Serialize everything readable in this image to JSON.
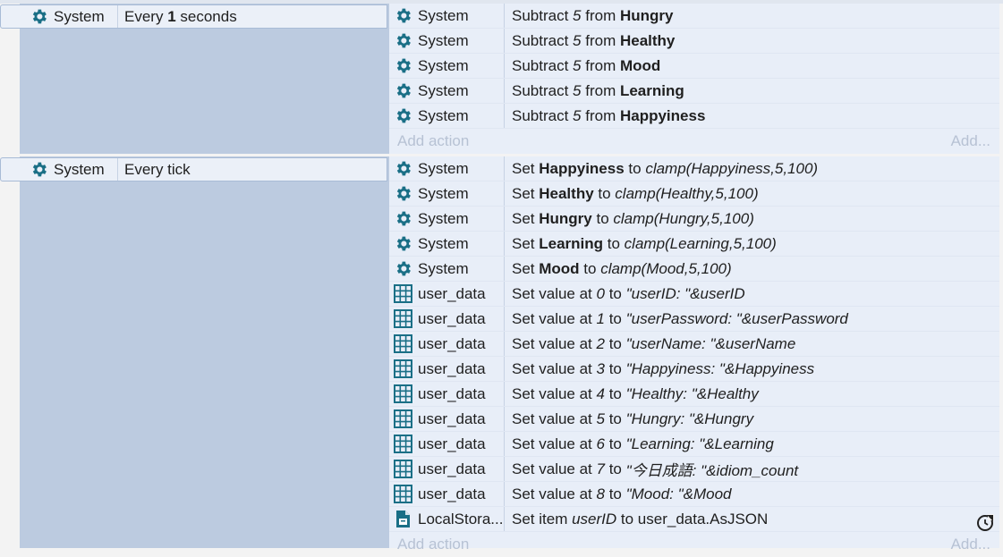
{
  "events": [
    {
      "condition": {
        "object": "System",
        "icon": "gear-icon",
        "text_parts": [
          [
            "Every ",
            "n"
          ],
          [
            "1",
            "b"
          ],
          [
            " seconds",
            "n"
          ]
        ]
      },
      "actions": [
        {
          "object": "System",
          "icon": "gear-icon",
          "parts": [
            [
              "Subtract ",
              "n"
            ],
            [
              "5",
              "i"
            ],
            [
              " from ",
              "n"
            ],
            [
              "Hungry",
              "b"
            ]
          ]
        },
        {
          "object": "System",
          "icon": "gear-icon",
          "parts": [
            [
              "Subtract ",
              "n"
            ],
            [
              "5",
              "i"
            ],
            [
              " from ",
              "n"
            ],
            [
              "Healthy",
              "b"
            ]
          ]
        },
        {
          "object": "System",
          "icon": "gear-icon",
          "parts": [
            [
              "Subtract ",
              "n"
            ],
            [
              "5",
              "i"
            ],
            [
              " from ",
              "n"
            ],
            [
              "Mood",
              "b"
            ]
          ]
        },
        {
          "object": "System",
          "icon": "gear-icon",
          "parts": [
            [
              "Subtract ",
              "n"
            ],
            [
              "5",
              "i"
            ],
            [
              " from ",
              "n"
            ],
            [
              "Learning",
              "b"
            ]
          ]
        },
        {
          "object": "System",
          "icon": "gear-icon",
          "parts": [
            [
              "Subtract ",
              "n"
            ],
            [
              "5",
              "i"
            ],
            [
              " from ",
              "n"
            ],
            [
              "Happyiness",
              "b"
            ]
          ]
        }
      ],
      "add_action": "Add action",
      "add_more": "Add..."
    },
    {
      "condition": {
        "object": "System",
        "icon": "gear-icon",
        "text_parts": [
          [
            "Every tick",
            "n"
          ]
        ]
      },
      "actions": [
        {
          "object": "System",
          "icon": "gear-icon",
          "parts": [
            [
              "Set ",
              "n"
            ],
            [
              "Happyiness",
              "b"
            ],
            [
              " to ",
              "n"
            ],
            [
              "clamp(Happyiness,5,100)",
              "i"
            ]
          ]
        },
        {
          "object": "System",
          "icon": "gear-icon",
          "parts": [
            [
              "Set ",
              "n"
            ],
            [
              "Healthy",
              "b"
            ],
            [
              " to ",
              "n"
            ],
            [
              "clamp(Healthy,5,100)",
              "i"
            ]
          ]
        },
        {
          "object": "System",
          "icon": "gear-icon",
          "parts": [
            [
              "Set ",
              "n"
            ],
            [
              "Hungry",
              "b"
            ],
            [
              " to ",
              "n"
            ],
            [
              "clamp(Hungry,5,100)",
              "i"
            ]
          ]
        },
        {
          "object": "System",
          "icon": "gear-icon",
          "parts": [
            [
              "Set ",
              "n"
            ],
            [
              "Learning",
              "b"
            ],
            [
              " to ",
              "n"
            ],
            [
              "clamp(Learning,5,100)",
              "i"
            ]
          ]
        },
        {
          "object": "System",
          "icon": "gear-icon",
          "parts": [
            [
              "Set ",
              "n"
            ],
            [
              "Mood",
              "b"
            ],
            [
              " to ",
              "n"
            ],
            [
              "clamp(Mood,5,100)",
              "i"
            ]
          ]
        },
        {
          "object": "user_data",
          "icon": "grid-icon",
          "parts": [
            [
              "Set value at ",
              "n"
            ],
            [
              "0",
              "i"
            ],
            [
              " to ",
              "n"
            ],
            [
              "\"userID: \"&userID",
              "i"
            ]
          ]
        },
        {
          "object": "user_data",
          "icon": "grid-icon",
          "parts": [
            [
              "Set value at ",
              "n"
            ],
            [
              "1",
              "i"
            ],
            [
              " to ",
              "n"
            ],
            [
              "\"userPassword: \"&userPassword",
              "i"
            ]
          ]
        },
        {
          "object": "user_data",
          "icon": "grid-icon",
          "parts": [
            [
              "Set value at ",
              "n"
            ],
            [
              "2",
              "i"
            ],
            [
              " to ",
              "n"
            ],
            [
              "\"userName: \"&userName",
              "i"
            ]
          ]
        },
        {
          "object": "user_data",
          "icon": "grid-icon",
          "parts": [
            [
              "Set value at ",
              "n"
            ],
            [
              "3",
              "i"
            ],
            [
              " to ",
              "n"
            ],
            [
              "\"Happyiness: \"&Happyiness",
              "i"
            ]
          ]
        },
        {
          "object": "user_data",
          "icon": "grid-icon",
          "parts": [
            [
              "Set value at ",
              "n"
            ],
            [
              "4",
              "i"
            ],
            [
              " to ",
              "n"
            ],
            [
              "\"Healthy: \"&Healthy",
              "i"
            ]
          ]
        },
        {
          "object": "user_data",
          "icon": "grid-icon",
          "parts": [
            [
              "Set value at ",
              "n"
            ],
            [
              "5",
              "i"
            ],
            [
              " to ",
              "n"
            ],
            [
              "\"Hungry: \"&Hungry",
              "i"
            ]
          ]
        },
        {
          "object": "user_data",
          "icon": "grid-icon",
          "parts": [
            [
              "Set value at ",
              "n"
            ],
            [
              "6",
              "i"
            ],
            [
              " to ",
              "n"
            ],
            [
              "\"Learning: \"&Learning",
              "i"
            ]
          ]
        },
        {
          "object": "user_data",
          "icon": "grid-icon",
          "parts": [
            [
              "Set value at ",
              "n"
            ],
            [
              "7",
              "i"
            ],
            [
              " to ",
              "n"
            ],
            [
              "\"今日成語: \"&idiom_count",
              "i"
            ]
          ]
        },
        {
          "object": "user_data",
          "icon": "grid-icon",
          "parts": [
            [
              "Set value at ",
              "n"
            ],
            [
              "8",
              "i"
            ],
            [
              " to ",
              "n"
            ],
            [
              "\"Mood: \"&Mood",
              "i"
            ]
          ]
        },
        {
          "object": "LocalStora...",
          "icon": "local-storage-icon",
          "parts": [
            [
              "Set item ",
              "n"
            ],
            [
              "userID",
              "i"
            ],
            [
              " to ",
              "n"
            ],
            [
              "user_data.AsJSON",
              "n"
            ]
          ]
        }
      ],
      "add_action": "Add action",
      "add_more": "Add..."
    }
  ],
  "colors": {
    "icon": "#1a6f86",
    "action_bg": "#e8eef8",
    "condition_bg": "#bccbe0",
    "add_text": "#b7c2d4"
  },
  "refresh_icon": "refresh-icon"
}
